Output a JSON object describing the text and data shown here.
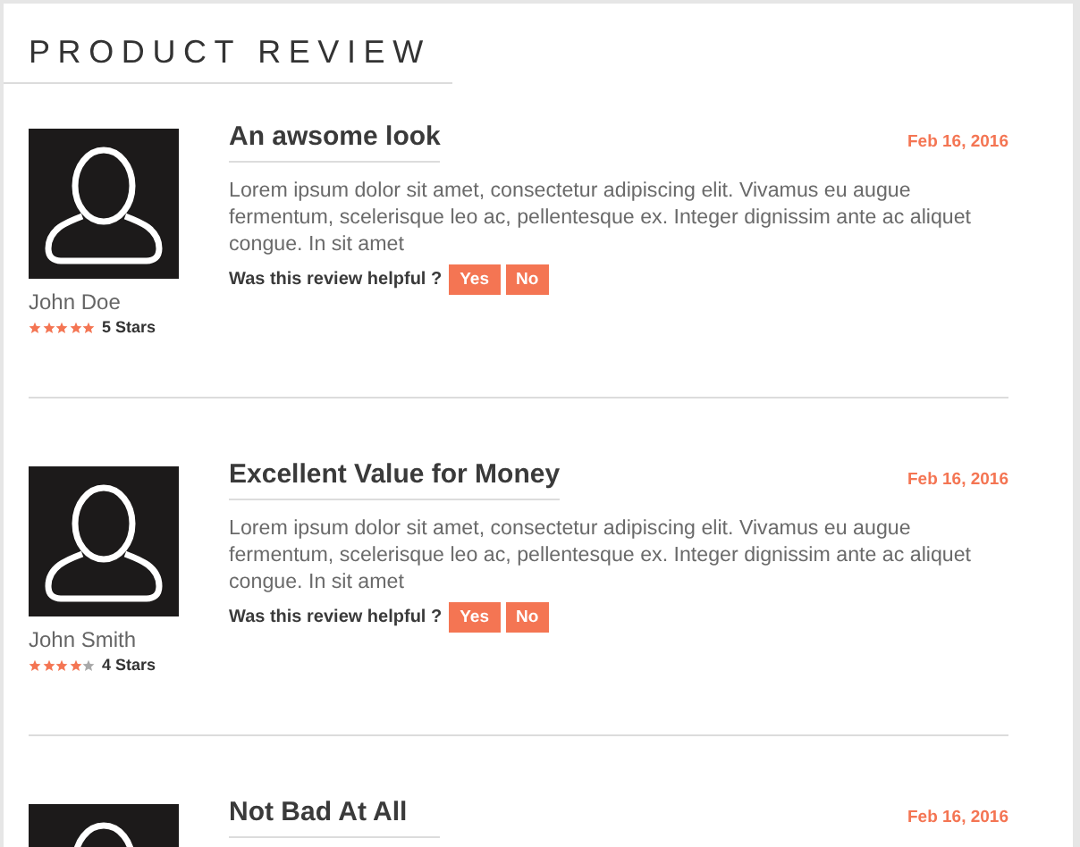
{
  "title": "PRODUCT REVIEW",
  "reviews": [
    {
      "title": "An awsome look",
      "date": "Feb 16, 2016",
      "body": "Lorem ipsum dolor sit amet, consectetur adipiscing elit. Vivamus eu augue fermentum, scelerisque leo ac, pellentesque ex. Integer dignissim ante ac aliquet congue. In sit amet",
      "helpful": "Was this review helpful ?",
      "yes": "Yes",
      "no": "No",
      "author": "John Doe",
      "stars": 5,
      "stars_label": "5 Stars"
    },
    {
      "title": "Excellent Value for Money",
      "date": "Feb 16, 2016",
      "body": "Lorem ipsum dolor sit amet, consectetur adipiscing elit. Vivamus eu augue fermentum, scelerisque leo ac, pellentesque ex. Integer dignissim ante ac aliquet congue. In sit amet",
      "helpful": "Was this review helpful ?",
      "yes": "Yes",
      "no": "No",
      "author": "John Smith",
      "stars": 4,
      "stars_label": "4 Stars"
    },
    {
      "title": "Not Bad At All",
      "date": "Feb 16, 2016"
    }
  ]
}
